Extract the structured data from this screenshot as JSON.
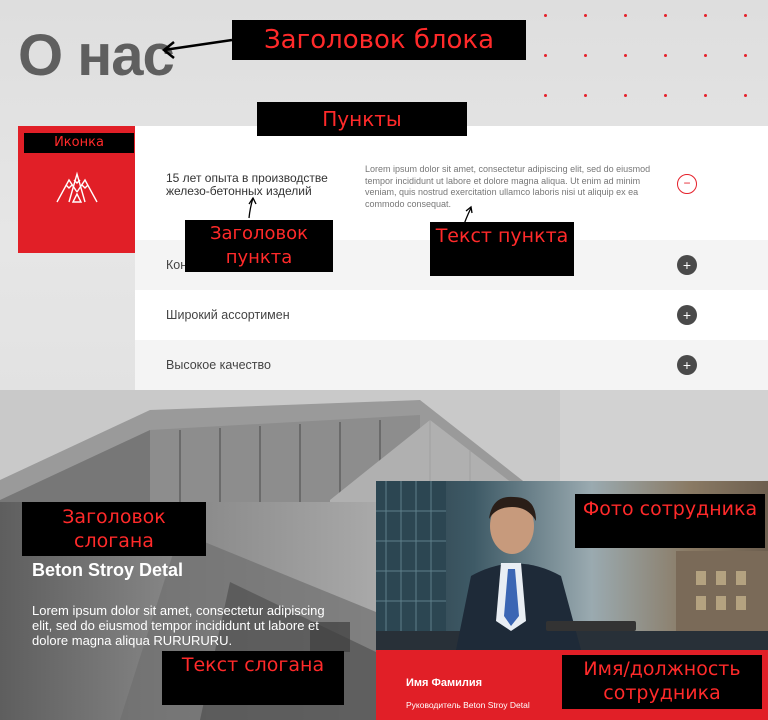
{
  "page": {
    "title": "О нас",
    "accent_color": "#e11f27"
  },
  "icon": {
    "name": "mountains-icon"
  },
  "accordion": {
    "open_item": {
      "title": "15 лет опыта в производстве железо-бетонных изделий",
      "text": "Lorem ipsum dolor sit amet, consectetur adipiscing elit, sed do eiusmod tempor incididunt ut labore et dolore magna aliqua. Ut enim ad minim veniam, quis nostrud exercitation ullamco laboris nisi ut aliquip ex ea commodo consequat.",
      "toggle": "−"
    },
    "items": [
      {
        "label": "Конкурентные цены",
        "toggle": "+"
      },
      {
        "label": "Широкий ассортимен",
        "toggle": "+"
      },
      {
        "label": "Высокое качество",
        "toggle": "+"
      }
    ]
  },
  "slogan": {
    "title": "Beton Stroy Detal",
    "text": "Lorem ipsum dolor sit amet, consectetur adipiscing elit, sed do eiusmod tempor incididunt ut labore et dolore magna aliqua RURURURU."
  },
  "employee": {
    "name": "Имя Фамилия",
    "role": "Руководитель Beton Stroy Detal"
  },
  "annotations": {
    "block_title": "Заголовок блока",
    "items": "Пункты",
    "icon": "Иконка",
    "item_title": "Заголовок пункта",
    "item_text": "Текст пункта",
    "slogan_title": "Заголовок слогана",
    "employee_photo": "Фото сотрудника",
    "slogan_text": "Текст слогана",
    "employee_name_role": "Имя/должность сотрудника"
  }
}
